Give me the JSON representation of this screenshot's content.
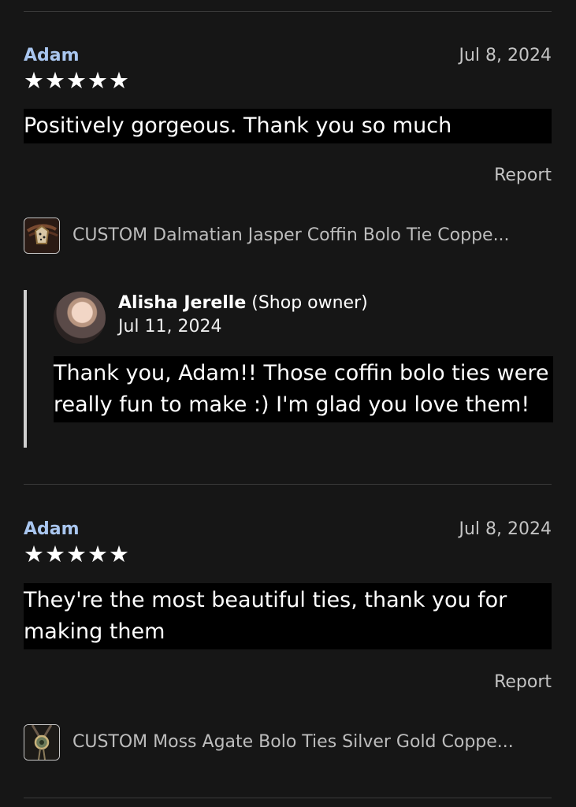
{
  "reviews": [
    {
      "reviewer": "Adam",
      "date": "Jul 8, 2024",
      "rating": 5,
      "stars": "★★★★★",
      "text": "Positively gorgeous. Thank you so much",
      "report": "Report",
      "product": "CUSTOM Dalmatian Jasper Coffin Bolo Tie Coppe..."
    },
    {
      "reviewer": "Adam",
      "date": "Jul 8, 2024",
      "rating": 5,
      "stars": "★★★★★",
      "text": "They're the most beautiful ties, thank you for making them",
      "report": "Report",
      "product": "CUSTOM Moss Agate Bolo Ties Silver Gold Coppe..."
    }
  ],
  "shop_reply": {
    "name": "Alisha Jerelle",
    "role": "(Shop owner)",
    "date": "Jul 11, 2024",
    "text": "Thank you, Adam!! Those coffin bolo ties were really fun to make :) I'm glad you love them!"
  },
  "colors": {
    "background": "#161616",
    "reviewer_name": "#a9c6ef",
    "muted_text": "#c4c4c4"
  }
}
